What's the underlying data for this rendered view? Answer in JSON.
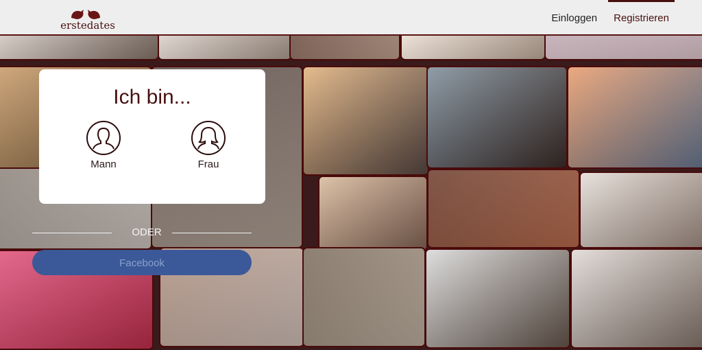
{
  "brand": {
    "name": "erstedates",
    "color": "#4a1010"
  },
  "nav": {
    "login_label": "Einloggen",
    "register_label": "Registrieren"
  },
  "chooser": {
    "title": "Ich bin...",
    "options": [
      {
        "label": "Mann",
        "icon": "male-user-icon"
      },
      {
        "label": "Frau",
        "icon": "female-user-icon"
      }
    ]
  },
  "divider": {
    "text": "ODER"
  },
  "facebook": {
    "label": "Facebook",
    "color": "#3b5998"
  },
  "mosaic": {
    "tiles": [
      {
        "name": "photo-couple-bed-top-left",
        "colors": [
          "#d9cfc8",
          "#8c7a70"
        ]
      },
      {
        "name": "photo-couple-top-2",
        "colors": [
          "#e0d6cf",
          "#b5a497"
        ]
      },
      {
        "name": "photo-couple-top-3",
        "colors": [
          "#6b4a3f",
          "#c8a894"
        ]
      },
      {
        "name": "photo-couple-top-4",
        "colors": [
          "#efe3d8",
          "#c9b3a3"
        ]
      },
      {
        "name": "photo-couple-top-5",
        "colors": [
          "#c2aab3",
          "#e8cfd6"
        ]
      },
      {
        "name": "photo-couple-picnic",
        "colors": [
          "#c99a66",
          "#7a5e3f"
        ]
      },
      {
        "name": "photo-couple-kiss-sunlight",
        "colors": [
          "#e0b07a",
          "#5b4a46"
        ]
      },
      {
        "name": "photo-couple-embrace-coats",
        "colors": [
          "#7c8c99",
          "#3d2e2a"
        ]
      },
      {
        "name": "photo-couple-sunset-pier",
        "colors": [
          "#e89a6a",
          "#6a7d9a"
        ]
      },
      {
        "name": "photo-couple-lying-bed",
        "colors": [
          "#8a8078",
          "#d8cfc8"
        ]
      },
      {
        "name": "photo-couple-christmas",
        "colors": [
          "#d8b89a",
          "#8a6a5a"
        ]
      },
      {
        "name": "photo-couple-bokeh-night",
        "colors": [
          "#6a3a2a",
          "#c07050"
        ]
      },
      {
        "name": "photo-couple-bed-laughing",
        "colors": [
          "#e4dcd6",
          "#a89488"
        ]
      },
      {
        "name": "photo-woman-red-shoe",
        "colors": [
          "#e0507a",
          "#c83050"
        ]
      },
      {
        "name": "photo-couple-bed-sheets",
        "colors": [
          "#b09080",
          "#d8c8c0"
        ]
      },
      {
        "name": "photo-couple-outdoor-hug",
        "colors": [
          "#7a6a5a",
          "#c8b8a8"
        ]
      },
      {
        "name": "photo-couple-under-blanket",
        "colors": [
          "#d8d8d8",
          "#6a5a50"
        ]
      },
      {
        "name": "photo-couple-sofa-hug",
        "colors": [
          "#e0d8d4",
          "#8a7a70"
        ]
      }
    ]
  }
}
